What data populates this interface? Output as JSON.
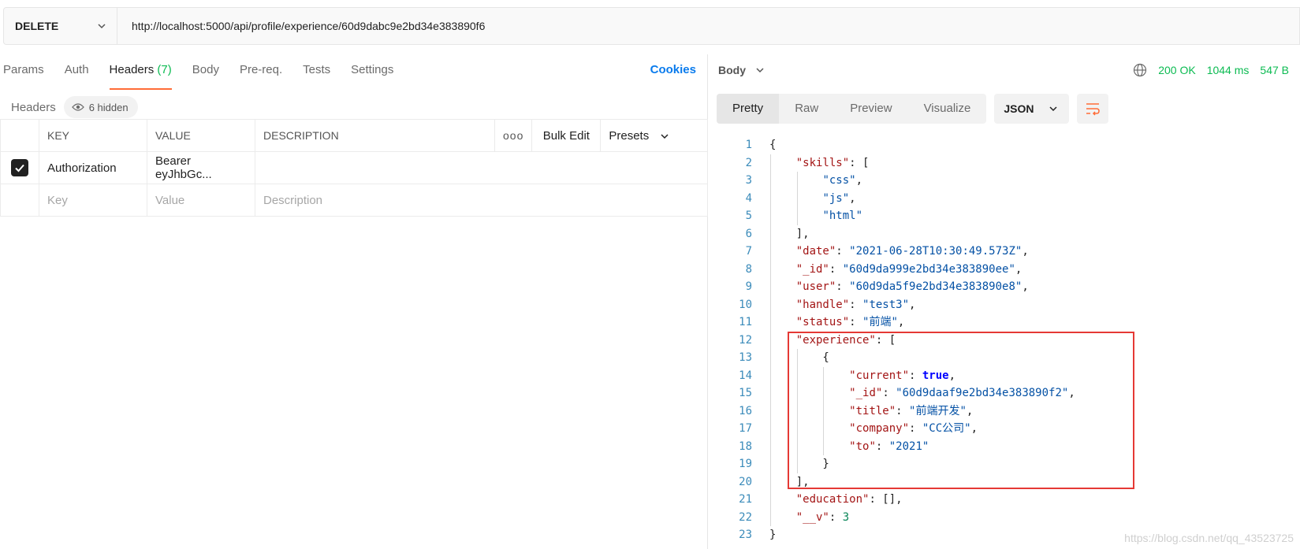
{
  "request": {
    "method": "DELETE",
    "url": "http://localhost:5000/api/profile/experience/60d9dabc9e2bd34e383890f6"
  },
  "request_tabs": [
    {
      "label": "Params"
    },
    {
      "label": "Auth"
    },
    {
      "label": "Headers",
      "count": "(7)"
    },
    {
      "label": "Body"
    },
    {
      "label": "Pre-req."
    },
    {
      "label": "Tests"
    },
    {
      "label": "Settings"
    }
  ],
  "cookies_label": "Cookies",
  "headers_section": {
    "title": "Headers",
    "hidden_label": "6 hidden"
  },
  "table": {
    "columns": {
      "key": "KEY",
      "value": "VALUE",
      "description": "DESCRIPTION",
      "more": "ooo",
      "bulk_edit": "Bulk Edit",
      "presets": "Presets"
    },
    "rows": [
      {
        "checked": true,
        "key": "Authorization",
        "value": "Bearer eyJhbGc...",
        "description": ""
      }
    ],
    "placeholders": {
      "key": "Key",
      "value": "Value",
      "description": "Description"
    }
  },
  "response": {
    "body_label": "Body",
    "status": "200 OK",
    "time": "1044 ms",
    "size": "547 B",
    "view_tabs": [
      "Pretty",
      "Raw",
      "Preview",
      "Visualize"
    ],
    "format": "JSON"
  },
  "code_lines": [
    "{",
    "    \"skills\": [",
    "        \"css\",",
    "        \"js\",",
    "        \"html\"",
    "    ],",
    "    \"date\": \"2021-06-28T10:30:49.573Z\",",
    "    \"_id\": \"60d9da999e2bd34e383890ee\",",
    "    \"user\": \"60d9da5f9e2bd34e383890e8\",",
    "    \"handle\": \"test3\",",
    "    \"status\": \"前端\",",
    "    \"experience\": [",
    "        {",
    "            \"current\": true,",
    "            \"_id\": \"60d9daaf9e2bd34e383890f2\",",
    "            \"title\": \"前端开发\",",
    "            \"company\": \"CC公司\",",
    "            \"to\": \"2021\"",
    "        }",
    "    ],",
    "    \"education\": [],",
    "    \"__v\": 3",
    "}"
  ],
  "watermark": "https://blog.csdn.net/qq_43523725",
  "colors": {
    "accent": "#ff6c37",
    "success": "#0cbb52",
    "link": "#097bed",
    "highlight": "#e53935"
  }
}
